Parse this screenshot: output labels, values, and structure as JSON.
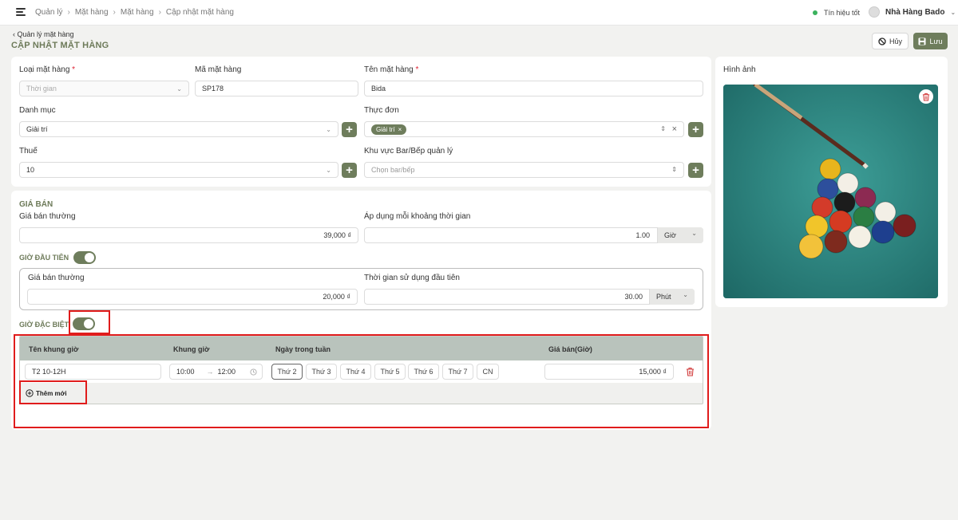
{
  "header": {
    "breadcrumbs": [
      "Quản lý",
      "Mặt hàng",
      "Mặt hàng",
      "Cập nhật mặt hàng"
    ],
    "signal_text": "Tín hiệu tốt",
    "store_name": "Nhà Hàng Bado"
  },
  "page": {
    "back_label": "Quản lý mặt hàng",
    "title": "CẬP NHẬT MẶT HÀNG",
    "cancel_label": "Hủy",
    "save_label": "Lưu"
  },
  "form": {
    "item_type": {
      "label": "Loại mặt hàng",
      "value": "Thời gian"
    },
    "item_code": {
      "label": "Mã mặt hàng",
      "value": "SP178"
    },
    "item_name": {
      "label": "Tên mặt hàng",
      "value": "Bida"
    },
    "category": {
      "label": "Danh mục",
      "value": "Giải trí"
    },
    "menu": {
      "label": "Thực đơn",
      "tag": "Giải trí"
    },
    "tax": {
      "label": "Thuế",
      "value": "10"
    },
    "area": {
      "label": "Khu vực Bar/Bếp quản lý",
      "placeholder": "Chọn bar/bếp"
    }
  },
  "pricing": {
    "section_title": "GIÁ BÁN",
    "regular_price": {
      "label": "Giá bán thường",
      "value": "39,000 ₫"
    },
    "interval": {
      "label": "Áp dụng mỗi khoảng thời gian",
      "value": "1.00",
      "unit": "Giờ"
    },
    "first_hour": {
      "title": "GIỜ ĐẦU TIÊN",
      "price_label": "Giá bán thường",
      "price_value": "20,000 ₫",
      "duration_label": "Thời gian sử dụng đầu tiên",
      "duration_value": "30.00",
      "duration_unit": "Phút"
    },
    "special_hours": {
      "title": "GIỜ ĐẶC BIỆT",
      "columns": [
        "Tên khung giờ",
        "Khung giờ",
        "Ngày trong tuần",
        "Giá bán(Giờ)"
      ],
      "row": {
        "name": "T2 10-12H",
        "start": "10:00",
        "end": "12:00",
        "days": [
          "Thứ 2",
          "Thứ 3",
          "Thứ 4",
          "Thứ 5",
          "Thứ 6",
          "Thứ 7",
          "CN"
        ],
        "selected_day": "Thứ 2",
        "price": "15,000 ₫"
      },
      "add_label": "Thêm mới"
    }
  },
  "image_panel": {
    "label": "Hình ảnh"
  },
  "colors": {
    "accent": "#6e7d5c",
    "highlight": "#e01c1c",
    "table_bar": "#b9c3bc"
  }
}
